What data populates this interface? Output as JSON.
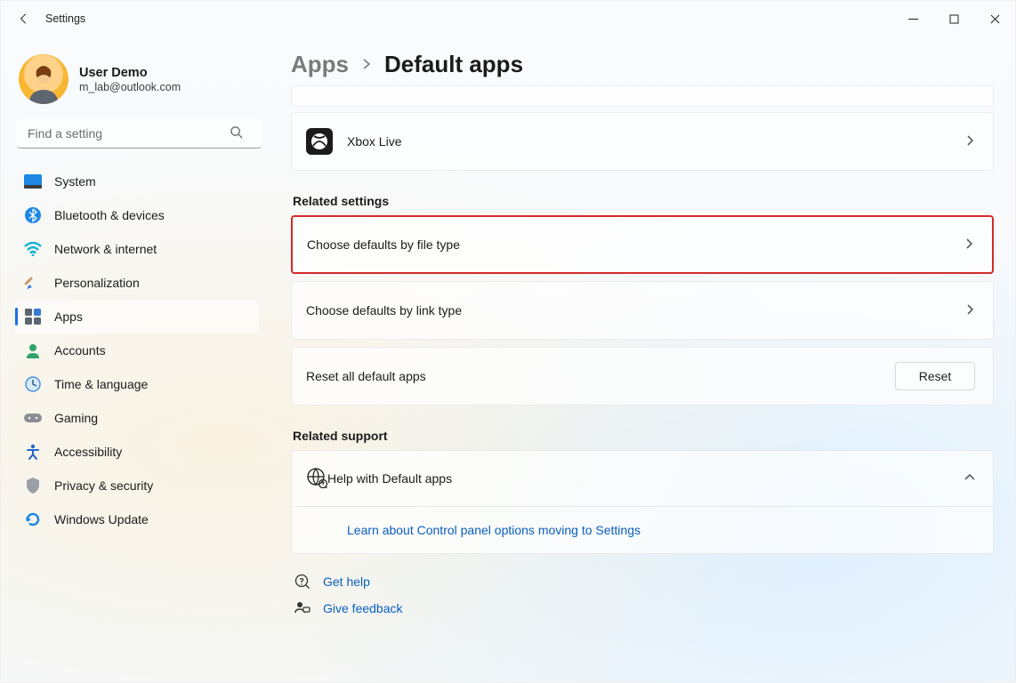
{
  "window": {
    "title": "Settings"
  },
  "user": {
    "name": "User Demo",
    "email": "m_lab@outlook.com"
  },
  "search": {
    "placeholder": "Find a setting"
  },
  "nav": {
    "items": [
      {
        "label": "System"
      },
      {
        "label": "Bluetooth & devices"
      },
      {
        "label": "Network & internet"
      },
      {
        "label": "Personalization"
      },
      {
        "label": "Apps"
      },
      {
        "label": "Accounts"
      },
      {
        "label": "Time & language"
      },
      {
        "label": "Gaming"
      },
      {
        "label": "Accessibility"
      },
      {
        "label": "Privacy & security"
      },
      {
        "label": "Windows Update"
      }
    ],
    "active_index": 4
  },
  "breadcrumb": {
    "parent": "Apps",
    "current": "Default apps"
  },
  "xbox_card": {
    "label": "Xbox Live"
  },
  "sections": {
    "related_settings": {
      "title": "Related settings",
      "choose_file": "Choose defaults by file type",
      "choose_link": "Choose defaults by link type",
      "reset_label": "Reset all default apps",
      "reset_button": "Reset"
    },
    "related_support": {
      "title": "Related support",
      "help_title": "Help with Default apps",
      "learn_link": "Learn about Control panel options moving to Settings"
    }
  },
  "footer": {
    "get_help": "Get help",
    "give_feedback": "Give feedback"
  }
}
